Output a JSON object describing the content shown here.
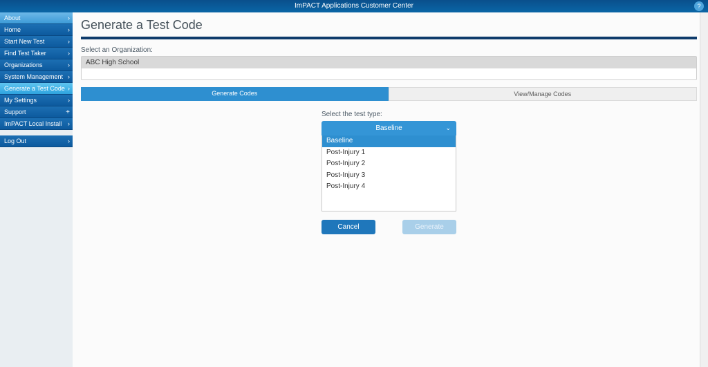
{
  "topbar": {
    "title": "ImPACT Applications Customer Center",
    "help_glyph": "?"
  },
  "sidebar": {
    "items": [
      {
        "label": "About",
        "style": "light",
        "icon": "chev"
      },
      {
        "label": "Home",
        "style": "dark",
        "icon": "chev"
      },
      {
        "label": "Start New Test",
        "style": "dark",
        "icon": "chev"
      },
      {
        "label": "Find Test Taker",
        "style": "dark",
        "icon": "chev"
      },
      {
        "label": "Organizations",
        "style": "dark",
        "icon": "chev"
      },
      {
        "label": "System Management",
        "style": "dark",
        "icon": "chev"
      },
      {
        "label": "Generate a Test Code",
        "style": "active",
        "icon": "chev"
      },
      {
        "label": "My Settings",
        "style": "dark",
        "icon": "chev"
      },
      {
        "label": "Support",
        "style": "dark",
        "icon": "plus"
      },
      {
        "label": "ImPACT Local Install",
        "style": "dark",
        "icon": "chev"
      },
      {
        "label": "Log Out",
        "style": "dark",
        "icon": "chev",
        "gapBefore": true
      }
    ]
  },
  "page": {
    "title": "Generate a Test Code",
    "org_label": "Select an Organization:",
    "org_selected": "ABC High School"
  },
  "tabs": {
    "generate": "Generate Codes",
    "view": "View/Manage Codes"
  },
  "test_type": {
    "label": "Select the test type:",
    "selected": "Baseline",
    "options": [
      "Baseline",
      "Post-Injury 1",
      "Post-Injury 2",
      "Post-Injury 3",
      "Post-Injury 4"
    ]
  },
  "buttons": {
    "cancel": "Cancel",
    "generate": "Generate"
  }
}
